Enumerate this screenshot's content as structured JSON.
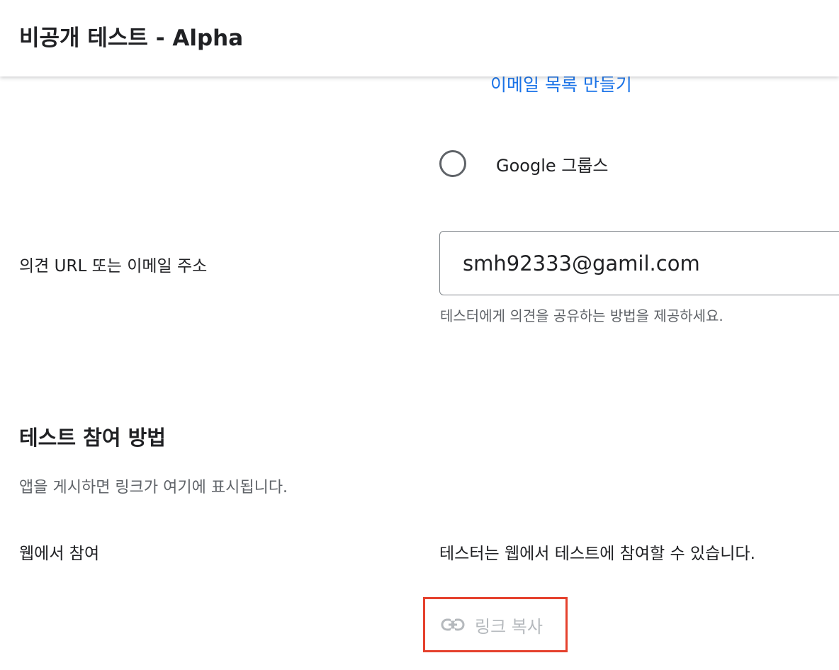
{
  "header": {
    "title": "비공개 테스트 - Alpha"
  },
  "scrolled_peek": {
    "link_text": "이메일 목록 만들기"
  },
  "tester_options": {
    "google_groups_label": "Google 그룹스"
  },
  "feedback": {
    "label": "의견 URL 또는 이메일 주소",
    "value": "smh92333@gamil.com",
    "help_text": "테스터에게 의견을 공유하는 방법을 제공하세요."
  },
  "join_section": {
    "title": "테스트 참여 방법",
    "description": "앱을 게시하면 링크가 여기에 표시됩니다.",
    "web_label": "웹에서 참여",
    "web_description": "테스터는 웹에서 테스트에 참여할 수 있습니다.",
    "copy_link_label": "링크 복사",
    "copy_icon": "link-icon"
  },
  "colors": {
    "link_blue": "#1a73e8",
    "highlight_red": "#e5412d",
    "disabled_gray": "#b5b9bd"
  }
}
